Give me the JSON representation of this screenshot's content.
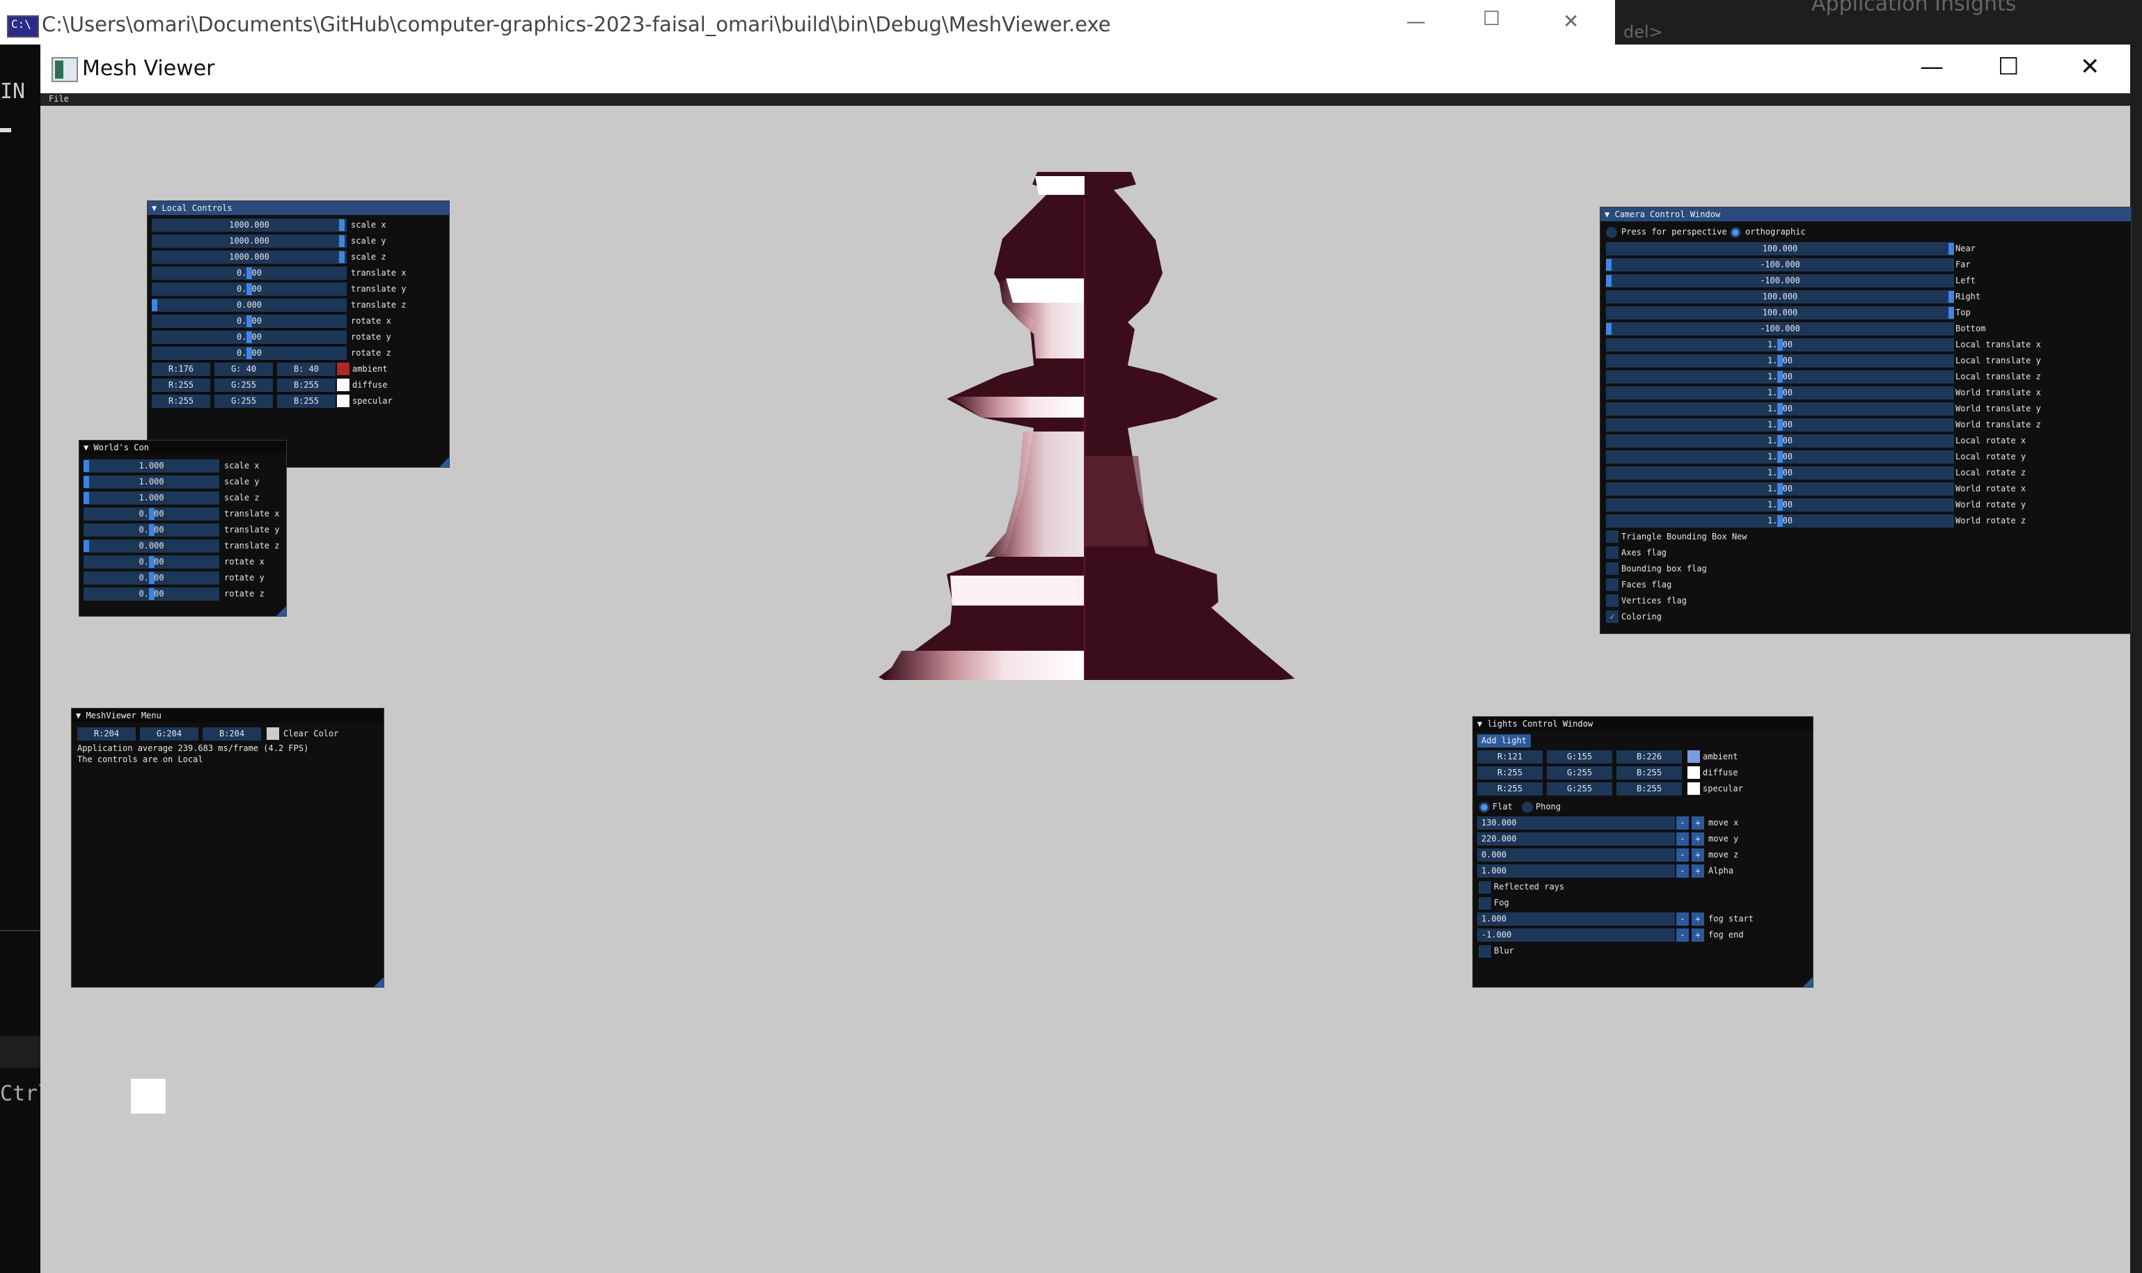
{
  "console": {
    "title": "C:\\Users\\omari\\Documents\\GitHub\\computer-graphics-2023-faisal_omari\\build\\bin\\Debug\\MeshViewer.exe",
    "icon_text": "C:\\",
    "left_text_1": "IN",
    "left_text_2": "Ctrl+"
  },
  "ide": {
    "dropdown": "del>",
    "insights": "Application Insights"
  },
  "app": {
    "title": "Mesh Viewer",
    "menu_file": "File"
  },
  "local_controls": {
    "title": "▼ Local Controls",
    "sliders": [
      {
        "value": "1000.000",
        "label": "scale x",
        "knob": 0.99
      },
      {
        "value": "1000.000",
        "label": "scale y",
        "knob": 0.99
      },
      {
        "value": "1000.000",
        "label": "scale z",
        "knob": 0.99
      },
      {
        "value": "0.000",
        "label": "translate x",
        "knob": 0.5
      },
      {
        "value": "0.000",
        "label": "translate y",
        "knob": 0.5
      },
      {
        "value": "0.000",
        "label": "translate z",
        "knob": 0.0
      },
      {
        "value": "0.000",
        "label": "rotate x",
        "knob": 0.5
      },
      {
        "value": "0.000",
        "label": "rotate y",
        "knob": 0.5
      },
      {
        "value": "0.000",
        "label": "rotate z",
        "knob": 0.5
      }
    ],
    "colors": [
      {
        "r": "R:176",
        "g": "G: 40",
        "b": "B: 40",
        "label": "ambient",
        "swatch": "#b02828"
      },
      {
        "r": "R:255",
        "g": "G:255",
        "b": "B:255",
        "label": "diffuse",
        "swatch": "#ffffff"
      },
      {
        "r": "R:255",
        "g": "G:255",
        "b": "B:255",
        "label": "specular",
        "swatch": "#ffffff"
      }
    ]
  },
  "world_controls": {
    "title": "▼ World's Con",
    "sliders": [
      {
        "value": "1.000",
        "label": "scale x",
        "knob": 0.0
      },
      {
        "value": "1.000",
        "label": "scale y",
        "knob": 0.0
      },
      {
        "value": "1.000",
        "label": "scale z",
        "knob": 0.0
      },
      {
        "value": "0.000",
        "label": "translate x",
        "knob": 0.5
      },
      {
        "value": "0.000",
        "label": "translate y",
        "knob": 0.5
      },
      {
        "value": "0.000",
        "label": "translate z",
        "knob": 0.0
      },
      {
        "value": "0.000",
        "label": "rotate x",
        "knob": 0.5
      },
      {
        "value": "0.000",
        "label": "rotate y",
        "knob": 0.5
      },
      {
        "value": "0.000",
        "label": "rotate z",
        "knob": 0.5
      }
    ]
  },
  "menu_window": {
    "title": "▼ MeshViewer Menu",
    "r": "R:204",
    "g": "G:204",
    "b": "B:204",
    "clear_label": "Clear Color",
    "swatch": "#cccccc",
    "line1": "Application average 239.683 ms/frame (4.2 FPS)",
    "line2": "The controls are on Local"
  },
  "camera": {
    "title": "▼ Camera Control Window",
    "perspective_label": "Press for perspective",
    "ortho_label": "orthographic",
    "sliders": [
      {
        "value": "100.000",
        "label": "Near",
        "knob": 1.0
      },
      {
        "value": "-100.000",
        "label": "Far",
        "knob": 0.0
      },
      {
        "value": "-100.000",
        "label": "Left",
        "knob": 0.0
      },
      {
        "value": "100.000",
        "label": "Right",
        "knob": 1.0
      },
      {
        "value": "100.000",
        "label": "Top",
        "knob": 1.0
      },
      {
        "value": "-100.000",
        "label": "Bottom",
        "knob": 0.0
      },
      {
        "value": "1.000",
        "label": "Local translate x",
        "knob": 0.5
      },
      {
        "value": "1.000",
        "label": "Local translate y",
        "knob": 0.5
      },
      {
        "value": "1.000",
        "label": "Local translate z",
        "knob": 0.5
      },
      {
        "value": "1.000",
        "label": "World translate x",
        "knob": 0.5
      },
      {
        "value": "1.000",
        "label": "World translate y",
        "knob": 0.5
      },
      {
        "value": "1.000",
        "label": "World translate z",
        "knob": 0.5
      },
      {
        "value": "1.000",
        "label": "Local rotate x",
        "knob": 0.5
      },
      {
        "value": "1.000",
        "label": "Local rotate y",
        "knob": 0.5
      },
      {
        "value": "1.000",
        "label": "Local rotate z",
        "knob": 0.5
      },
      {
        "value": "1.000",
        "label": "World rotate x",
        "knob": 0.5
      },
      {
        "value": "1.000",
        "label": "World rotate y",
        "knob": 0.5
      },
      {
        "value": "1.000",
        "label": "World rotate z",
        "knob": 0.5
      }
    ],
    "flags": [
      {
        "label": "Triangle Bounding Box New",
        "checked": false
      },
      {
        "label": "Axes flag",
        "checked": false
      },
      {
        "label": "Bounding box flag",
        "checked": false
      },
      {
        "label": "Faces flag",
        "checked": false
      },
      {
        "label": "Vertices flag",
        "checked": false
      },
      {
        "label": "Coloring",
        "checked": true
      }
    ]
  },
  "lights": {
    "title": "▼ lights Control Window",
    "add_light": "Add light",
    "colors": [
      {
        "r": "R:121",
        "g": "G:155",
        "b": "B:226",
        "label": "ambient",
        "swatch": "#799be2"
      },
      {
        "r": "R:255",
        "g": "G:255",
        "b": "B:255",
        "label": "diffuse",
        "swatch": "#ffffff"
      },
      {
        "r": "R:255",
        "g": "G:255",
        "b": "B:255",
        "label": "specular",
        "swatch": "#ffffff"
      }
    ],
    "flat_label": "Flat",
    "phong_label": "Phong",
    "inputs": [
      {
        "value": "130.000",
        "label": "move x"
      },
      {
        "value": "220.000",
        "label": "move y"
      },
      {
        "value": "0.000",
        "label": "move z"
      },
      {
        "value": "1.000",
        "label": "Alpha"
      }
    ],
    "reflected_label": "Reflected rays",
    "fog_label": "Fog",
    "fog_inputs": [
      {
        "value": "1.000",
        "label": "fog start"
      },
      {
        "value": "-1.000",
        "label": "fog end"
      }
    ],
    "blur_label": "Blur",
    "minus": "-",
    "plus": "+"
  }
}
